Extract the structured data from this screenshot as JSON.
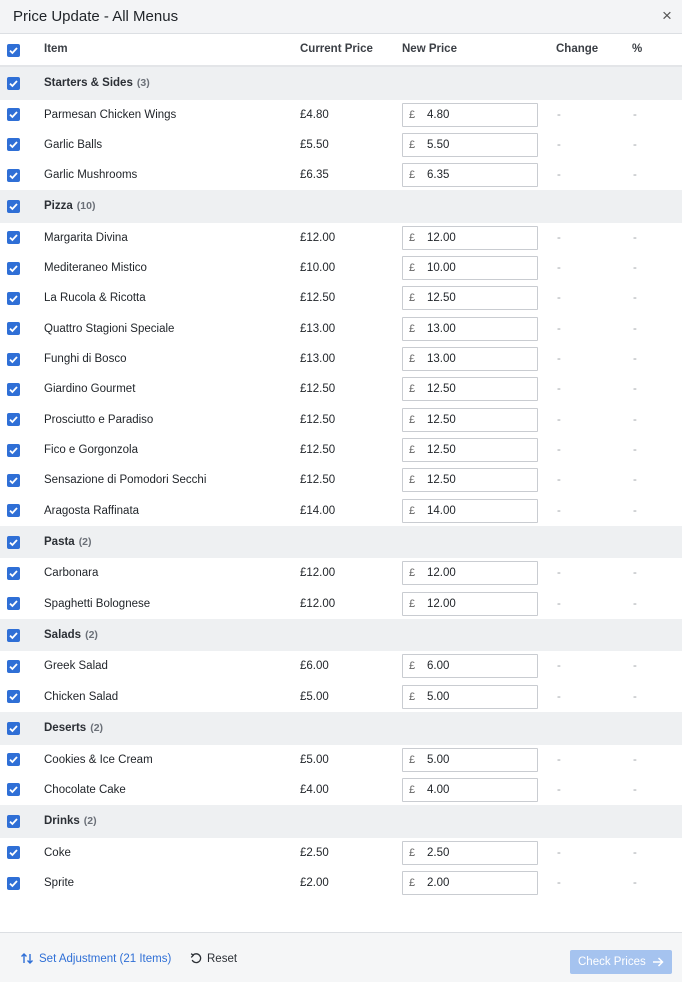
{
  "window": {
    "title": "Price Update - All Menus",
    "close_glyph": "×"
  },
  "columns": {
    "item": "Item",
    "current": "Current Price",
    "new": "New Price",
    "change": "Change",
    "pct": "%"
  },
  "currency": "£",
  "groups": [
    {
      "name": "Starters & Sides",
      "count": "(3)",
      "items": [
        {
          "name": "Parmesan Chicken Wings",
          "current": "£4.80",
          "new": "4.80",
          "change": "-",
          "pct": "-"
        },
        {
          "name": "Garlic Balls",
          "current": "£5.50",
          "new": "5.50",
          "change": "-",
          "pct": "-"
        },
        {
          "name": "Garlic Mushrooms",
          "current": "£6.35",
          "new": "6.35",
          "change": "-",
          "pct": "-"
        }
      ]
    },
    {
      "name": "Pizza",
      "count": "(10)",
      "items": [
        {
          "name": "Margarita Divina",
          "current": "£12.00",
          "new": "12.00",
          "change": "-",
          "pct": "-"
        },
        {
          "name": "Mediteraneo Mistico",
          "current": "£10.00",
          "new": "10.00",
          "change": "-",
          "pct": "-"
        },
        {
          "name": "La Rucola & Ricotta",
          "current": "£12.50",
          "new": "12.50",
          "change": "-",
          "pct": "-"
        },
        {
          "name": "Quattro Stagioni Speciale",
          "current": "£13.00",
          "new": "13.00",
          "change": "-",
          "pct": "-"
        },
        {
          "name": "Funghi di Bosco",
          "current": "£13.00",
          "new": "13.00",
          "change": "-",
          "pct": "-"
        },
        {
          "name": "Giardino Gourmet",
          "current": "£12.50",
          "new": "12.50",
          "change": "-",
          "pct": "-"
        },
        {
          "name": "Prosciutto e Paradiso",
          "current": "£12.50",
          "new": "12.50",
          "change": "-",
          "pct": "-"
        },
        {
          "name": "Fico e Gorgonzola",
          "current": "£12.50",
          "new": "12.50",
          "change": "-",
          "pct": "-"
        },
        {
          "name": "Sensazione di Pomodori Secchi",
          "current": "£12.50",
          "new": "12.50",
          "change": "-",
          "pct": "-"
        },
        {
          "name": "Aragosta Raffinata",
          "current": "£14.00",
          "new": "14.00",
          "change": "-",
          "pct": "-"
        }
      ]
    },
    {
      "name": "Pasta",
      "count": "(2)",
      "items": [
        {
          "name": "Carbonara",
          "current": "£12.00",
          "new": "12.00",
          "change": "-",
          "pct": "-"
        },
        {
          "name": "Spaghetti Bolognese",
          "current": "£12.00",
          "new": "12.00",
          "change": "-",
          "pct": "-"
        }
      ]
    },
    {
      "name": "Salads",
      "count": "(2)",
      "items": [
        {
          "name": "Greek Salad",
          "current": "£6.00",
          "new": "6.00",
          "change": "-",
          "pct": "-"
        },
        {
          "name": "Chicken Salad",
          "current": "£5.00",
          "new": "5.00",
          "change": "-",
          "pct": "-"
        }
      ]
    },
    {
      "name": "Deserts",
      "count": "(2)",
      "items": [
        {
          "name": "Cookies & Ice Cream",
          "current": "£5.00",
          "new": "5.00",
          "change": "-",
          "pct": "-"
        },
        {
          "name": "Chocolate Cake",
          "current": "£4.00",
          "new": "4.00",
          "change": "-",
          "pct": "-"
        }
      ]
    },
    {
      "name": "Drinks",
      "count": "(2)",
      "items": [
        {
          "name": "Coke",
          "current": "£2.50",
          "new": "2.50",
          "change": "-",
          "pct": "-"
        },
        {
          "name": "Sprite",
          "current": "£2.00",
          "new": "2.00",
          "change": "-",
          "pct": "-"
        }
      ]
    }
  ],
  "footer": {
    "set_adjustment": "Set Adjustment (21 Items)",
    "reset": "Reset",
    "check_prices": "Check Prices"
  },
  "colors": {
    "accent": "#2f6fd6",
    "check_button_disabled": "#a5c3ef",
    "group_row_bg": "#eef0f2"
  },
  "icons": {
    "checkbox": "checkbox-checked-icon",
    "sort": "sort-arrows-icon",
    "reset": "reset-icon",
    "arrow": "arrow-right-icon",
    "close": "close-icon"
  }
}
